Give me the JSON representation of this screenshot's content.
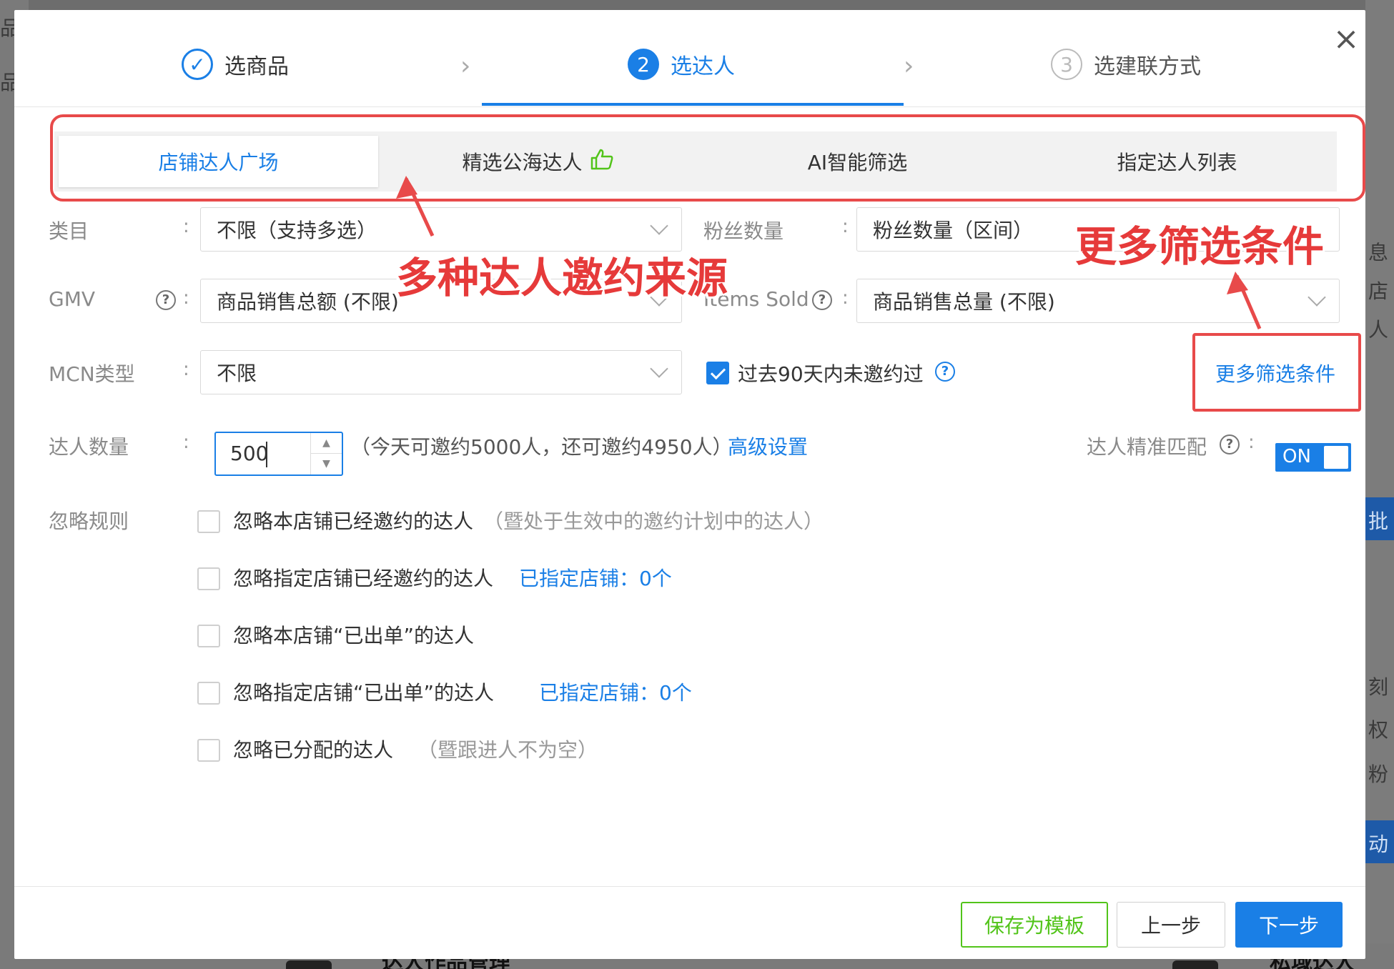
{
  "background": {
    "left_chars": [
      "品",
      "品"
    ],
    "right_chars": [
      "息",
      "店",
      "人",
      "批",
      "刻",
      "权",
      "粉",
      "动"
    ],
    "bottom_items": [
      "达人作品管理",
      "私域达人"
    ]
  },
  "steps": [
    {
      "number": "✓",
      "label": "选商品",
      "state": "done"
    },
    {
      "number": "2",
      "label": "选达人",
      "state": "active"
    },
    {
      "number": "3",
      "label": "选建联方式",
      "state": "wait"
    }
  ],
  "close_icon": "close-icon",
  "tabs": [
    {
      "label": "店铺达人广场",
      "active": true
    },
    {
      "label": "精选公海达人",
      "icon": "thumbs-up-icon"
    },
    {
      "label": "AI智能筛选"
    },
    {
      "label": "指定达人列表"
    }
  ],
  "form": {
    "category": {
      "label": "类目",
      "value": "不限（支持多选）"
    },
    "fans": {
      "label": "粉丝数量",
      "value": "粉丝数量（区间）"
    },
    "gmv": {
      "label": "GMV",
      "value": "商品销售总额 (不限)"
    },
    "items_sold": {
      "label": "Items Sold",
      "value": "商品销售总量 (不限)"
    },
    "mcn": {
      "label": "MCN类型",
      "value": "不限"
    },
    "not_invited": {
      "label": "过去90天内未邀约过",
      "checked": true
    },
    "more_filters": "更多筛选条件",
    "count": {
      "label": "达人数量",
      "value": "500",
      "hint": "（今天可邀约5000人，还可邀约4950人）",
      "advanced": "高级设置"
    },
    "precise": {
      "label": "达人精准匹配",
      "toggle": "ON"
    },
    "ignore_label": "忽略规则",
    "ignore_rules": [
      {
        "text": "忽略本店铺已经邀约的达人",
        "note": "（暨处于生效中的邀约计划中的达人）",
        "link": ""
      },
      {
        "text": "忽略指定店铺已经邀约的达人",
        "note": "",
        "link": "已指定店铺：0个"
      },
      {
        "text": "忽略本店铺“已出单”的达人",
        "note": "",
        "link": ""
      },
      {
        "text": "忽略指定店铺“已出单”的达人",
        "note": "",
        "link": "已指定店铺：0个"
      },
      {
        "text": "忽略已分配的达人",
        "note": "（暨跟进人不为空）",
        "link": ""
      }
    ]
  },
  "footer": {
    "save_template": "保存为模板",
    "prev": "上一步",
    "next": "下一步"
  },
  "annotations": {
    "sources": "多种达人邀约来源",
    "more_filters": "更多筛选条件",
    "color": "#e84a4a"
  }
}
